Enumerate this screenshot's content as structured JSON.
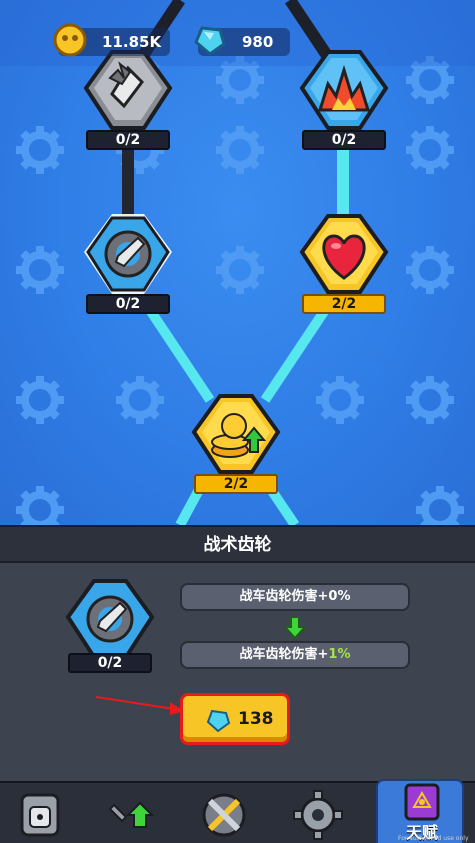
{
  "currency": {
    "coins": "11.85K",
    "gems": "980"
  },
  "nodes": {
    "top_left_progress": "0/2",
    "top_right_progress": "0/2",
    "mid_left_progress": "0/2",
    "mid_right_progress": "2/2",
    "bottom_progress": "2/2"
  },
  "panel": {
    "title": "战术齿轮",
    "selected_progress": "0/2",
    "stat_current_prefix": "战车齿轮伤害+",
    "stat_current_value": "0%",
    "stat_next_prefix": "战车齿轮伤害+",
    "stat_next_value": "1%",
    "cost": "138"
  },
  "nav": {
    "active_label": "天赋",
    "fineprint": "For authorized use only"
  },
  "colors": {
    "background_blue": "#2f7de6",
    "connector_active": "#57e7ef",
    "connector_locked": "#23262f",
    "gold": "#f8c526",
    "highlight_red": "#e81b1b"
  }
}
